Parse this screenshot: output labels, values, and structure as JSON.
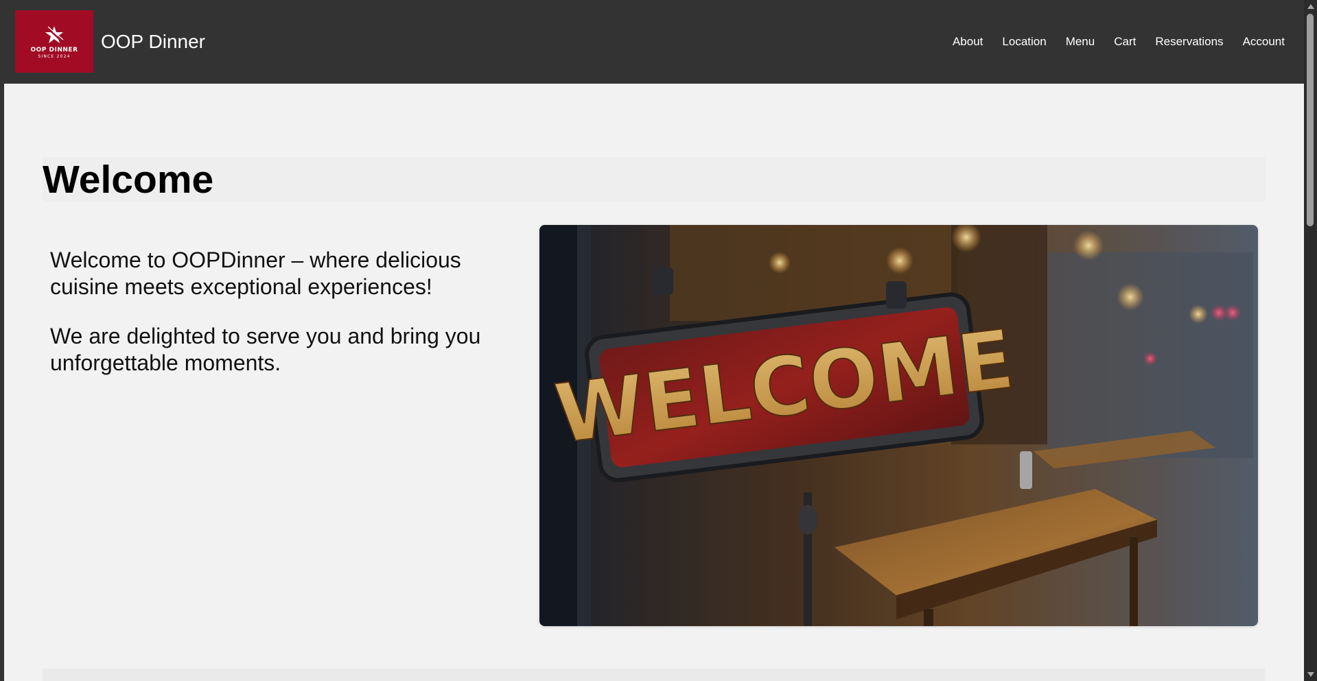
{
  "header": {
    "logo": {
      "main_text": "OOP DINNER",
      "sub_text": "SINCE 2024",
      "icon": "star-logo-icon",
      "background_color": "#a10c24"
    },
    "brand_name": "OOP Dinner",
    "nav": [
      {
        "label": "About"
      },
      {
        "label": "Location"
      },
      {
        "label": "Menu"
      },
      {
        "label": "Cart"
      },
      {
        "label": "Reservations"
      },
      {
        "label": "Account"
      }
    ]
  },
  "main": {
    "title": "Welcome",
    "paragraphs": [
      "Welcome to OOPDinner – where delicious cuisine meets exceptional experiences!",
      "We are delighted to serve you and bring you unforgettable moments."
    ],
    "hero_image": {
      "sign_text": "WELCOME",
      "description_icon": "welcome-sign-image"
    }
  },
  "colors": {
    "header_bg": "#333333",
    "page_bg": "#f2f2f2",
    "accent": "#a10c24"
  }
}
